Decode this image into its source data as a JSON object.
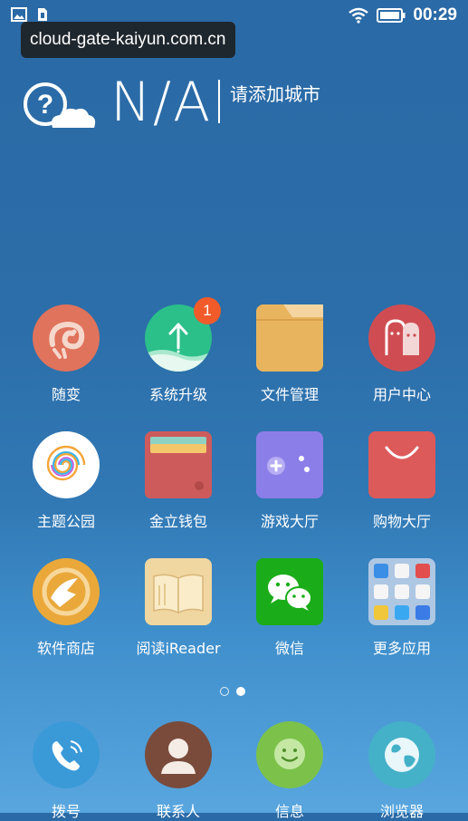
{
  "status_bar": {
    "time": "00:29"
  },
  "url_overlay": "cloud-gate-kaiyun.com.cn",
  "weather": {
    "temperature": "N/A",
    "add_city": "请添加城市"
  },
  "apps": [
    {
      "label": "随变",
      "icon": "chameleon-icon",
      "color": "#e0735b"
    },
    {
      "label": "系统升级",
      "icon": "upgrade-arrow-icon",
      "color": "#2bbf8a",
      "badge": "1"
    },
    {
      "label": "文件管理",
      "icon": "folder-icon",
      "color": "#e8b45e"
    },
    {
      "label": "用户中心",
      "icon": "user-faces-icon",
      "color": "#cf4d52"
    },
    {
      "label": "主题公园",
      "icon": "spiral-theme-icon",
      "color": "#ffffff"
    },
    {
      "label": "金立钱包",
      "icon": "wallet-icon",
      "color": "#cd5b5c"
    },
    {
      "label": "游戏大厅",
      "icon": "gamepad-icon",
      "color": "#8c7ee8"
    },
    {
      "label": "购物大厅",
      "icon": "shopping-bag-icon",
      "color": "#dc5a5a"
    },
    {
      "label": "软件商店",
      "icon": "software-store-icon",
      "color": "#eaa83a"
    },
    {
      "label": "阅读iReader",
      "icon": "book-icon",
      "color": "#f0d6a0"
    },
    {
      "label": "微信",
      "icon": "wechat-icon",
      "color": "#1aad19"
    },
    {
      "label": "更多应用",
      "icon": "app-folder-icon",
      "color": "#aec7e3"
    }
  ],
  "dock": [
    {
      "label": "拨号",
      "icon": "phone-icon",
      "color": "#3a9ad8"
    },
    {
      "label": "联系人",
      "icon": "contact-icon",
      "color": "#7a4b3b"
    },
    {
      "label": "信息",
      "icon": "message-smiley-icon",
      "color": "#7cc24a"
    },
    {
      "label": "浏览器",
      "icon": "globe-icon",
      "color": "#44b1c8"
    }
  ]
}
